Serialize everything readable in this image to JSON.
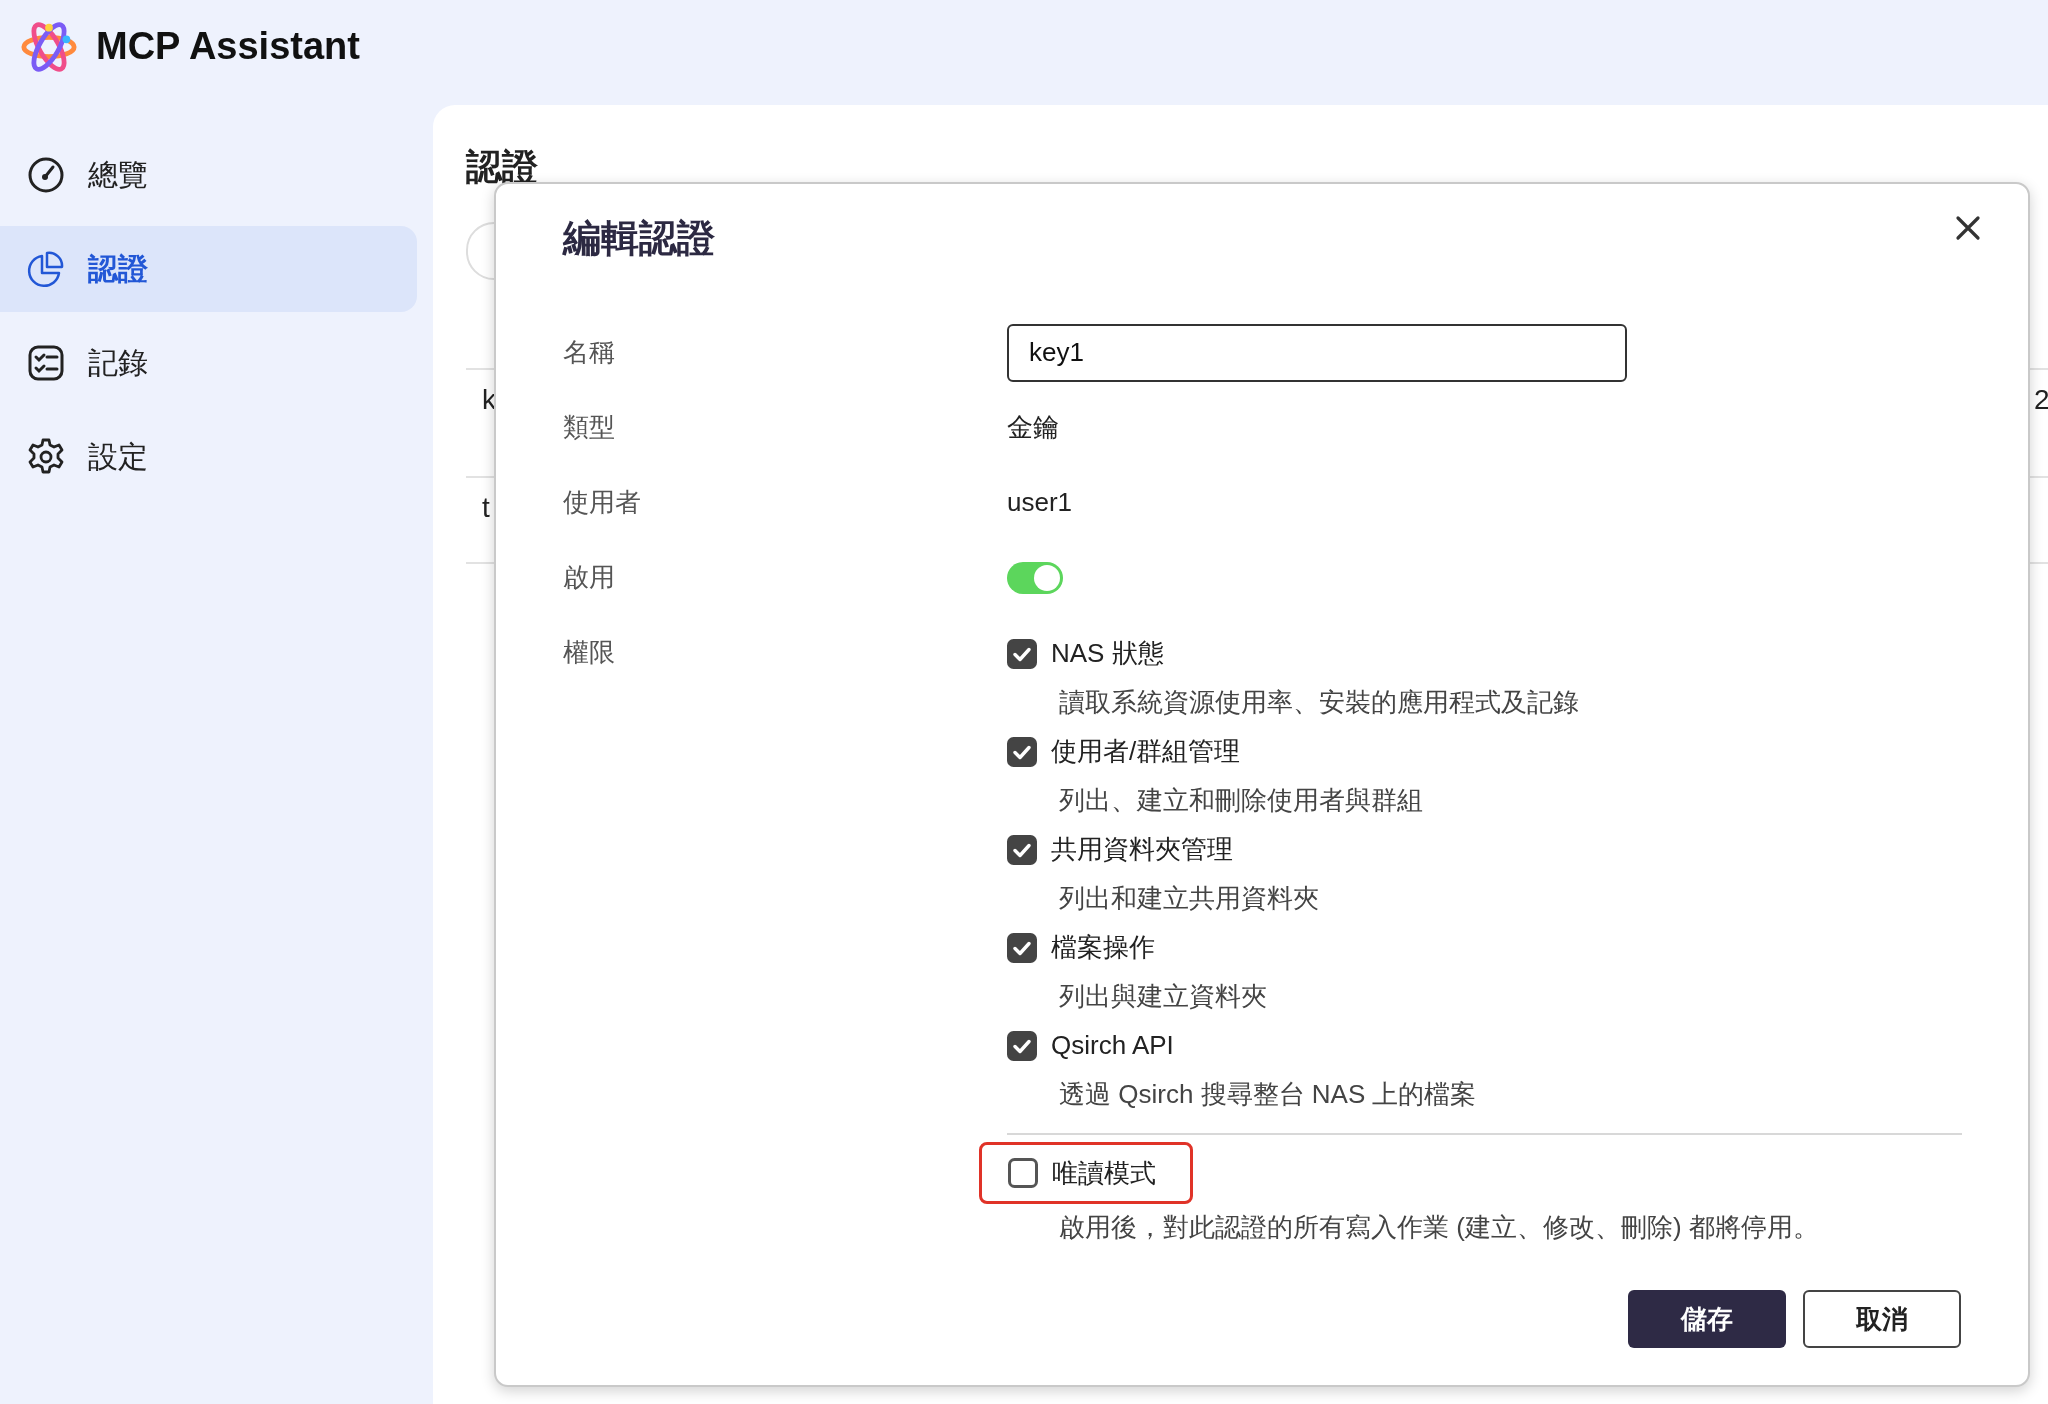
{
  "app": {
    "title": "MCP Assistant"
  },
  "nav": [
    {
      "label": "總覽",
      "selected": false
    },
    {
      "label": "認證",
      "selected": true
    },
    {
      "label": "記錄",
      "selected": false
    },
    {
      "label": "設定",
      "selected": false
    }
  ],
  "page": {
    "title": "認證",
    "table": {
      "rows": [
        {
          "cells": [
            "k",
            "2"
          ]
        },
        {
          "cells": [
            "t"
          ]
        }
      ]
    }
  },
  "dialog": {
    "title": "編輯認證",
    "fields": [
      {
        "kind": "input",
        "label": "名稱",
        "value": "key1"
      },
      {
        "kind": "text",
        "label": "類型",
        "value": "金鑰"
      },
      {
        "kind": "text",
        "label": "使用者",
        "value": "user1"
      },
      {
        "kind": "toggle",
        "label": "啟用",
        "on": true
      },
      {
        "kind": "permissions",
        "label": "權限"
      }
    ],
    "permissions": [
      {
        "label": "NAS 狀態",
        "description": "讀取系統資源使用率、安裝的應用程式及記錄",
        "checked": true
      },
      {
        "label": "使用者/群組管理",
        "description": "列出、建立和刪除使用者與群組",
        "checked": true
      },
      {
        "label": "共用資料夾管理",
        "description": "列出和建立共用資料夾",
        "checked": true
      },
      {
        "label": "檔案操作",
        "description": "列出與建立資料夾",
        "checked": true
      },
      {
        "label": "Qsirch API",
        "description": "透過 Qsirch 搜尋整台 NAS 上的檔案",
        "checked": true
      }
    ],
    "read_only": {
      "label": "唯讀模式",
      "description": "啟用後，對此認證的所有寫入作業 (建立、修改、刪除) 都將停用。",
      "checked": false,
      "highlighted": true
    },
    "buttons": [
      {
        "label": "儲存",
        "kind": "primary"
      },
      {
        "label": "取消",
        "kind": "secondary"
      }
    ]
  }
}
